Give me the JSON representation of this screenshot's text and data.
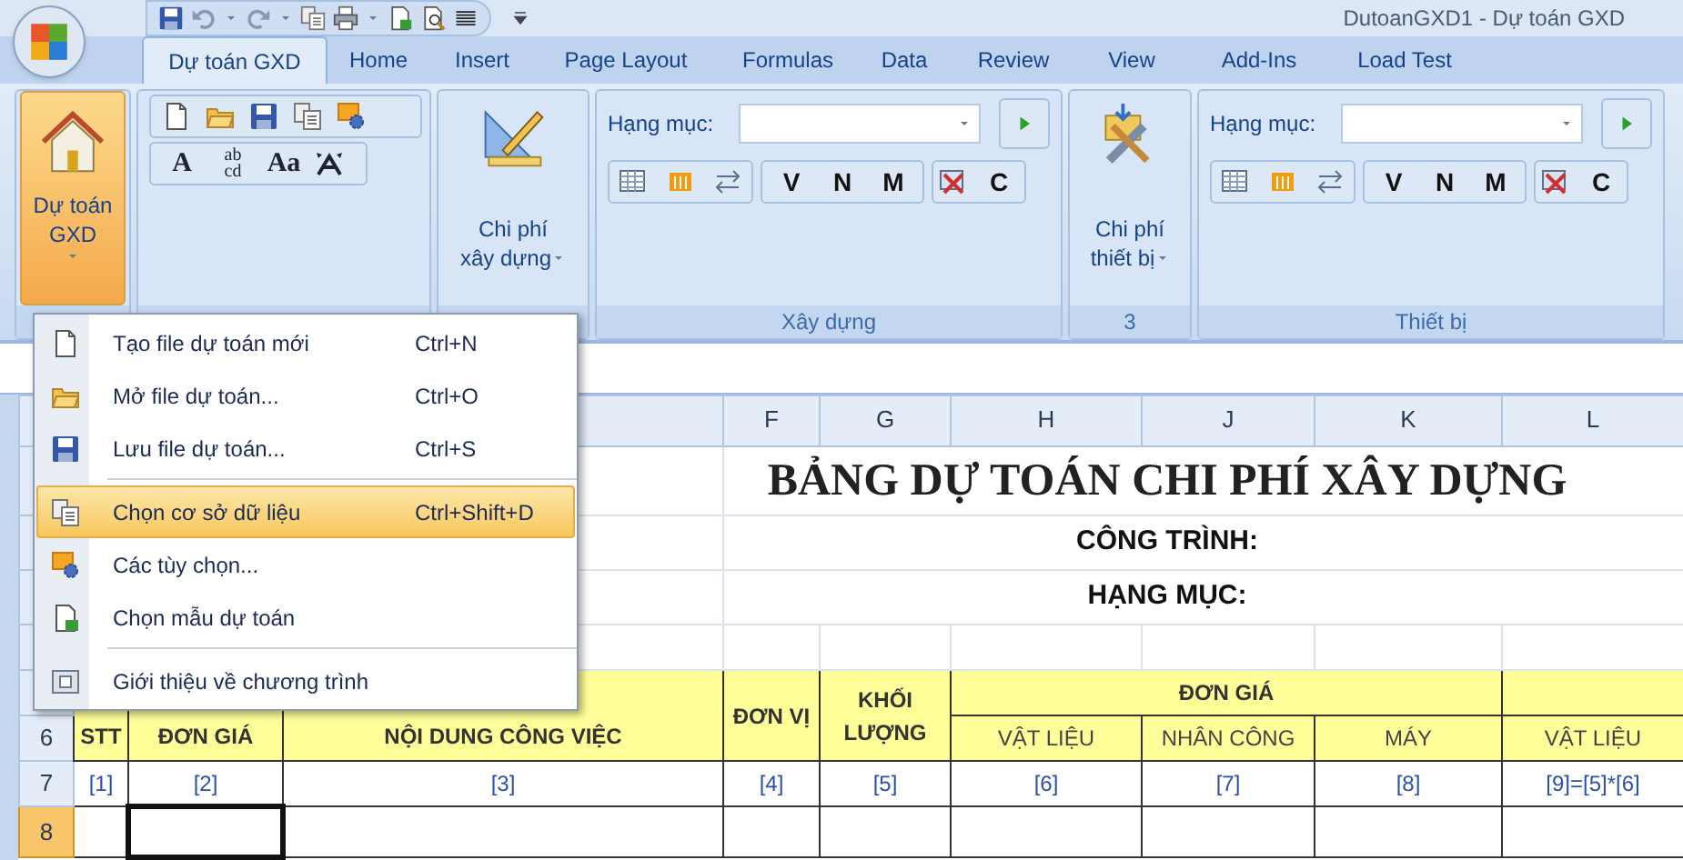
{
  "window": {
    "title": "DutoanGXD1 - Dự toán GXD"
  },
  "tabs": [
    {
      "label": "Dự toán GXD",
      "selected": true
    },
    {
      "label": "Home",
      "selected": false
    },
    {
      "label": "Insert",
      "selected": false
    },
    {
      "label": "Page Layout",
      "selected": false
    },
    {
      "label": "Formulas",
      "selected": false
    },
    {
      "label": "Data",
      "selected": false
    },
    {
      "label": "Review",
      "selected": false
    },
    {
      "label": "View",
      "selected": false
    },
    {
      "label": "Add-Ins",
      "selected": false
    },
    {
      "label": "Load Test",
      "selected": false
    }
  ],
  "ribbon": {
    "groups": [
      {
        "kind": "main",
        "lines": [
          "Dự toán",
          "GXD"
        ],
        "pressed": true
      },
      {
        "kind": "tools",
        "text_tools": [
          {
            "top": "A"
          },
          {
            "top": "ab",
            "bottom": "cd"
          },
          {
            "top": "Aa"
          }
        ]
      },
      {
        "kind": "construction_cost",
        "lines": [
          "Chi phí",
          "xây dựng"
        ]
      },
      {
        "kind": "category",
        "field_label": "Hạng mục:",
        "letters": [
          "V",
          "N",
          "M"
        ],
        "extra_letter": "C",
        "label": "Xây dựng"
      },
      {
        "kind": "equipment_cost",
        "lines": [
          "Chi phí",
          "thiết bị"
        ],
        "label": "3"
      },
      {
        "kind": "category",
        "field_label": "Hạng mục:",
        "letters": [
          "V",
          "N",
          "M"
        ],
        "extra_letter": "C",
        "label": "Thiết bị"
      }
    ]
  },
  "menu": {
    "items": [
      {
        "label": "Tạo file dự toán mới",
        "shortcut": "Ctrl+N",
        "selected": false
      },
      {
        "label": "Mở file dự toán...",
        "shortcut": "Ctrl+O",
        "selected": false
      },
      {
        "label": "Lưu file dự toán...",
        "shortcut": "Ctrl+S",
        "selected": false
      },
      {
        "label": "Chọn cơ sở dữ liệu",
        "shortcut": "Ctrl+Shift+D",
        "selected": true,
        "separator_before": true
      },
      {
        "label": "Các tùy chọn...",
        "selected": false
      },
      {
        "label": "Chọn mẫu dự toán",
        "selected": false
      },
      {
        "label": "Giới thiệu về chương trình",
        "selected": false,
        "separator_before": true
      }
    ]
  },
  "sheet": {
    "column_headers": [
      "F",
      "G",
      "H",
      "J",
      "K",
      "L"
    ],
    "title": "BẢNG DỰ TOÁN CHI PHÍ XÂY DỰNG",
    "lines": [
      "CÔNG TRÌNH:",
      "HẠNG MỤC:"
    ],
    "header_cells": [
      "STT",
      "ĐƠN GIÁ",
      "NỘI DUNG CÔNG VIỆC",
      "ĐƠN VỊ",
      "KHỐI LƯỢNG"
    ],
    "group_header": "ĐƠN GIÁ",
    "sub_headers": [
      "VẬT LIỆU",
      "NHÂN CÔNG",
      "MÁY",
      "VẬT LIỆU"
    ],
    "index_row": [
      "[1]",
      "[2]",
      "[3]",
      "[4]",
      "[5]",
      "[6]",
      "[7]",
      "[8]",
      "[9]=[5]*[6]"
    ],
    "row_numbers": [
      {
        "label": "6",
        "selected": false
      },
      {
        "label": "7",
        "selected": false
      },
      {
        "label": "8",
        "selected": true
      }
    ]
  }
}
